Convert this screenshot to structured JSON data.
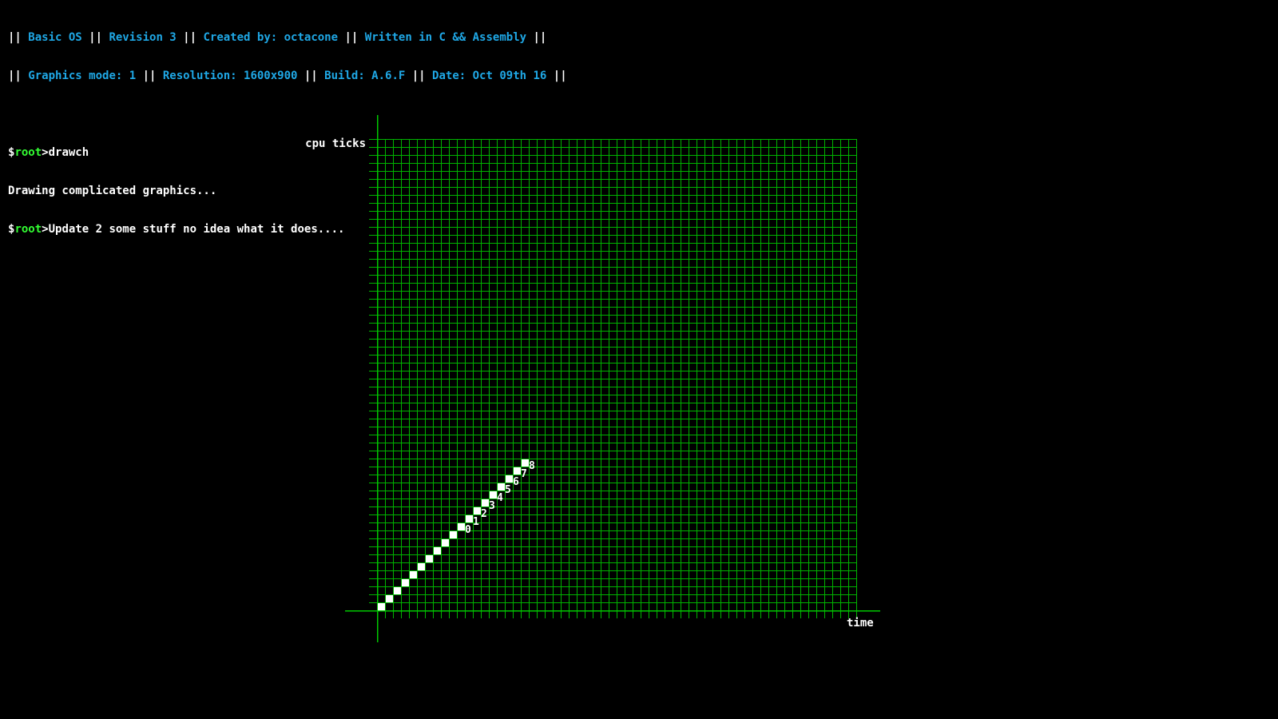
{
  "banner": {
    "line1": [
      {
        "sep": "|| ",
        "text": "Basic OS"
      },
      {
        "sep": " || ",
        "text": "Revision 3"
      },
      {
        "sep": " || ",
        "text": "Created by: octacone"
      },
      {
        "sep": " || ",
        "text": "Written in C && Assembly"
      }
    ],
    "line1_end": " ||",
    "line2": [
      {
        "sep": "|| ",
        "text": "Graphics mode: 1"
      },
      {
        "sep": " || ",
        "text": "Resolution: 1600x900"
      },
      {
        "sep": " || ",
        "text": "Build: A.6.F"
      },
      {
        "sep": " || ",
        "text": "Date: Oct 09th 16"
      }
    ],
    "line2_end": " ||"
  },
  "console": {
    "prompt_prefix": "$",
    "prompt_user": "root",
    "prompt_suffix": ">",
    "command1": "drawch",
    "output1": "Drawing complicated graphics...",
    "command2": "Update 2 some stuff no idea what it does...."
  },
  "colors": {
    "background": "#000000",
    "text": "#ffffff",
    "info": "#1fa8e6",
    "user": "#33ff33",
    "grid": "#00b400",
    "axis": "#00c800",
    "points": "#ffffff"
  },
  "chart_data": {
    "type": "scatter",
    "title": "",
    "xlabel": "time",
    "ylabel": "cpu ticks",
    "grid": true,
    "grid_columns": 60,
    "grid_rows": 59,
    "series": [
      {
        "x": [
          0,
          1,
          2,
          3,
          4,
          5,
          6,
          7,
          8,
          9,
          10,
          11,
          12,
          13,
          14,
          15,
          16,
          17,
          18
        ],
        "y": [
          0,
          1,
          2,
          3,
          4,
          5,
          6,
          7,
          8,
          9,
          10,
          11,
          12,
          13,
          14,
          15,
          16,
          17,
          18
        ]
      }
    ],
    "point_labels": [
      {
        "label": "0",
        "x": 10,
        "y": 10
      },
      {
        "label": "1",
        "x": 11,
        "y": 11
      },
      {
        "label": "2",
        "x": 12,
        "y": 12
      },
      {
        "label": "3",
        "x": 13,
        "y": 13
      },
      {
        "label": "4",
        "x": 14,
        "y": 14
      },
      {
        "label": "5",
        "x": 15,
        "y": 15
      },
      {
        "label": "6",
        "x": 16,
        "y": 16
      },
      {
        "label": "7",
        "x": 17,
        "y": 17
      },
      {
        "label": "8",
        "x": 18,
        "y": 18
      }
    ]
  }
}
